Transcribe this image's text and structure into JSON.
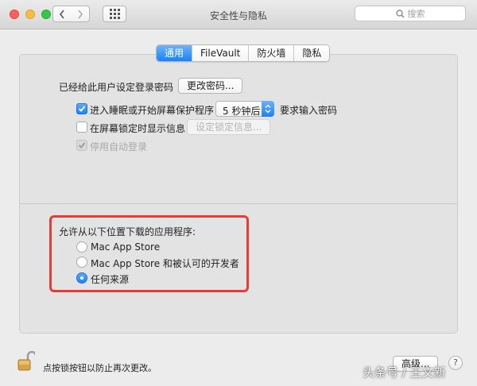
{
  "window": {
    "title": "安全性与隐私"
  },
  "toolbar": {
    "search_placeholder": "搜索"
  },
  "tabs": [
    {
      "label": "通用",
      "active": true
    },
    {
      "label": "FileVault",
      "active": false
    },
    {
      "label": "防火墙",
      "active": false
    },
    {
      "label": "隐私",
      "active": false
    }
  ],
  "general": {
    "password_label": "已经给此用户设定登录密码",
    "change_password_button": "更改密码...",
    "require_password": {
      "label": "进入睡眠或开始屏幕保护程序",
      "checked": true,
      "delay_value": "5 秒钟后",
      "suffix": "要求输入密码"
    },
    "show_message": {
      "label": "在屏幕锁定时显示信息",
      "checked": false,
      "button": "设定锁定信息..."
    },
    "disable_auto_login": {
      "label": "停用自动登录",
      "checked": true,
      "disabled": true
    }
  },
  "downloads": {
    "heading": "允许从以下位置下载的应用程序:",
    "options": [
      {
        "label": "Mac App Store",
        "selected": false
      },
      {
        "label": "Mac App Store 和被认可的开发者",
        "selected": false
      },
      {
        "label": "任何来源",
        "selected": true
      }
    ]
  },
  "footer": {
    "lock_text": "点按锁按钮以防止再次更改。",
    "advanced_button": "高级...",
    "help": "?"
  },
  "watermark": "头条号 / 王文新",
  "colors": {
    "accent": "#1a82f7",
    "highlight": "#e73b37"
  }
}
